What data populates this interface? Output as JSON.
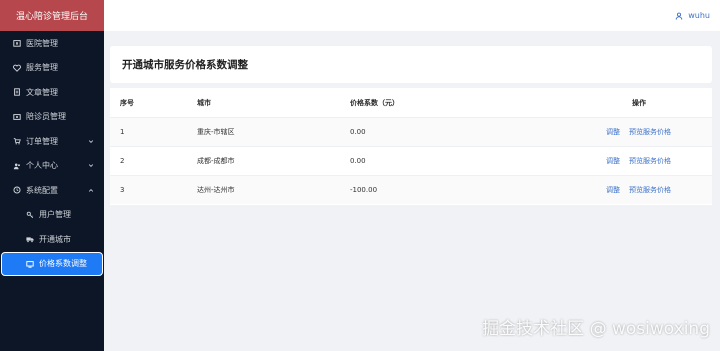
{
  "brand": "温心陪诊管理后台",
  "sidebar": {
    "items": [
      {
        "label": "医院管理",
        "icon": "hospital-icon"
      },
      {
        "label": "服务管理",
        "icon": "heart-icon"
      },
      {
        "label": "文章管理",
        "icon": "document-icon"
      },
      {
        "label": "陪诊员管理",
        "icon": "staff-icon"
      },
      {
        "label": "订单管理",
        "icon": "cart-icon",
        "arrow": "chevron-down-icon"
      },
      {
        "label": "个人中心",
        "icon": "user-group-icon",
        "arrow": "chevron-down-icon"
      },
      {
        "label": "系统配置",
        "icon": "clock-icon",
        "arrow": "chevron-up-icon"
      }
    ],
    "subitems": [
      {
        "label": "用户管理",
        "icon": "key-icon"
      },
      {
        "label": "开通城市",
        "icon": "truck-icon"
      },
      {
        "label": "价格系数调整",
        "icon": "screen-icon"
      }
    ]
  },
  "topbar": {
    "username": "wuhu",
    "user_icon": "user-icon"
  },
  "page": {
    "title": "开通城市服务价格系数调整"
  },
  "table": {
    "headers": {
      "seq": "序号",
      "city": "城市",
      "coef": "价格系数（元）",
      "op": "操作"
    },
    "rows": [
      {
        "seq": "1",
        "city": "重庆-市辖区",
        "coef": "0.00",
        "adjust": "调整",
        "preview": "预览服务价格"
      },
      {
        "seq": "2",
        "city": "成都-成都市",
        "coef": "0.00",
        "adjust": "调整",
        "preview": "预览服务价格"
      },
      {
        "seq": "3",
        "city": "达州-达州市",
        "coef": "-100.00",
        "adjust": "调整",
        "preview": "预览服务价格"
      }
    ]
  },
  "watermark": "掘金技术社区 @ wosiwoxing",
  "colors": {
    "brand_bg": "#b5474d",
    "sidebar_bg": "#0c1626",
    "active_bg": "#1f7af5",
    "link": "#3d72c9"
  }
}
